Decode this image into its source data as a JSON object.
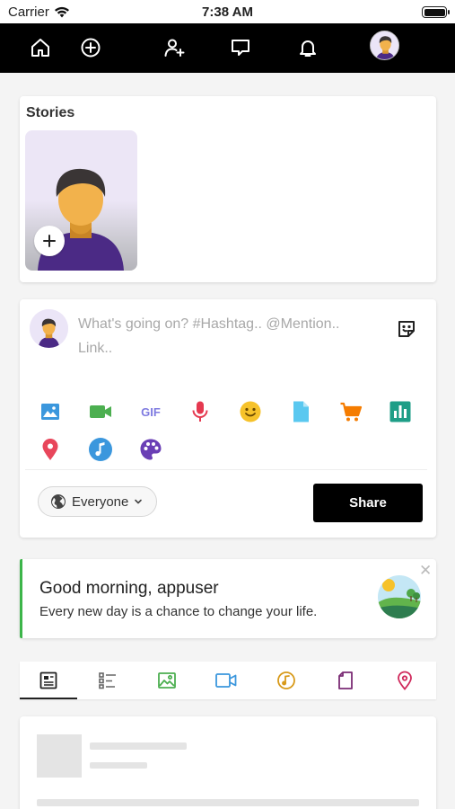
{
  "status_bar": {
    "carrier": "Carrier",
    "time": "7:38 AM",
    "battery_level": 1.0
  },
  "nav": {
    "items": [
      {
        "name": "home",
        "icon": "home-icon"
      },
      {
        "name": "create",
        "icon": "plus-circle-icon"
      },
      {
        "name": "add-friend",
        "icon": "user-plus-icon"
      },
      {
        "name": "messages",
        "icon": "chat-icon"
      },
      {
        "name": "notifications",
        "icon": "bell-icon"
      }
    ],
    "avatar_icon": "user-avatar-icon"
  },
  "stories": {
    "title": "Stories",
    "add_icon": "plus-icon"
  },
  "composer": {
    "placeholder": "What's going on? #Hashtag.. @Mention.. Link..",
    "tools": [
      {
        "name": "image",
        "icon": "image-icon",
        "color": "#3b97dd"
      },
      {
        "name": "video",
        "icon": "video-camera-icon",
        "color": "#4caf50"
      },
      {
        "name": "gif",
        "icon": "gif-icon",
        "color": "#7e7ae0"
      },
      {
        "name": "audio",
        "icon": "microphone-icon",
        "color": "#e53950"
      },
      {
        "name": "feeling",
        "icon": "smiley-icon",
        "color": "#f6c22a"
      },
      {
        "name": "file",
        "icon": "file-icon",
        "color": "#5ac8f0"
      },
      {
        "name": "product",
        "icon": "cart-icon",
        "color": "#f57c00"
      },
      {
        "name": "poll",
        "icon": "poll-chart-icon",
        "color": "#1e9e87"
      },
      {
        "name": "location",
        "icon": "location-pin-icon",
        "color": "#e8465b"
      },
      {
        "name": "music",
        "icon": "music-note-icon",
        "color": "#3b97dd"
      },
      {
        "name": "color",
        "icon": "palette-icon",
        "color": "#6a3fb5"
      }
    ],
    "privacy_label": "Everyone",
    "share_label": "Share"
  },
  "greeting": {
    "title": "Good morning, appuser",
    "subtitle": "Every new day is a chance to change your life.",
    "close_label": "✕",
    "accent_color": "#3cb54a"
  },
  "feed_tabs": [
    {
      "name": "all",
      "icon": "newspaper-icon",
      "color": "#222222",
      "active": true
    },
    {
      "name": "text",
      "icon": "list-icon",
      "color": "#666666",
      "active": false
    },
    {
      "name": "photos",
      "icon": "image-icon",
      "color": "#4caf50",
      "active": false
    },
    {
      "name": "videos",
      "icon": "video-camera-icon",
      "color": "#3b97dd",
      "active": false
    },
    {
      "name": "music",
      "icon": "music-disc-icon",
      "color": "#d89a1a",
      "active": false
    },
    {
      "name": "files",
      "icon": "file-icon",
      "color": "#7b2c75",
      "active": false
    },
    {
      "name": "places",
      "icon": "location-pin-icon",
      "color": "#d02a5c",
      "active": false
    }
  ]
}
